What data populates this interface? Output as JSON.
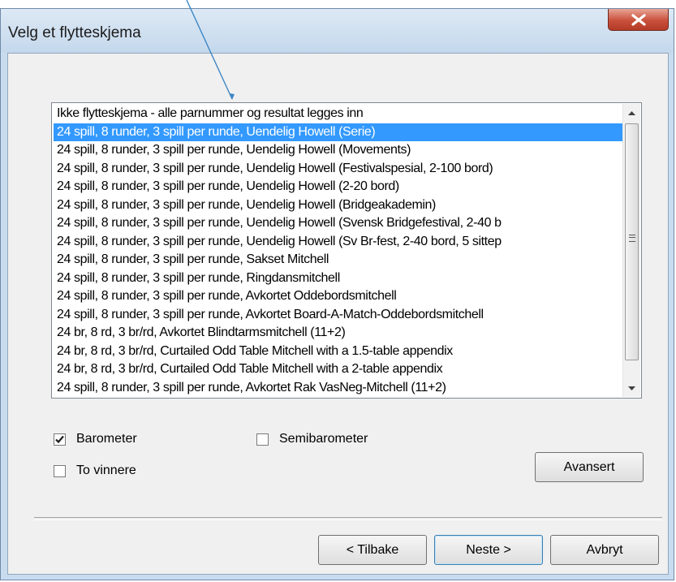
{
  "window": {
    "title": "Velg et flytteskjema"
  },
  "list": {
    "selected_index": 1,
    "items": [
      "Ikke flytteskjema - alle parnummer og resultat legges inn",
      "24 spill, 8 runder, 3 spill per runde, Uendelig Howell (Serie)",
      "24 spill, 8 runder, 3 spill per runde, Uendelig Howell (Movements)",
      "24 spill, 8 runder, 3 spill per runde, Uendelig Howell (Festivalspesial, 2-100 bord)",
      "24 spill, 8 runder, 3 spill per runde, Uendelig Howell (2-20 bord)",
      "24 spill, 8 runder, 3 spill per runde, Uendelig Howell (Bridgeakademin)",
      "24 spill, 8 runder, 3 spill per runde, Uendelig Howell (Svensk Bridgefestival, 2-40 b",
      "24 spill, 8 runder, 3 spill per runde, Uendelig Howell (Sv Br-fest, 2-40 bord, 5 sittep",
      "24 spill, 8 runder, 3 spill per runde, Sakset Mitchell",
      "24 spill, 8 runder, 3 spill per runde, Ringdansmitchell",
      "24 spill, 8 runder, 3 spill per runde, Avkortet Oddebordsmitchell",
      "24 spill, 8 runder, 3 spill per runde, Avkortet Board-A-Match-Oddebordsmitchell",
      "24 br, 8 rd, 3 br/rd, Avkortet Blindtarmsmitchell (11+2)",
      "24 br, 8 rd, 3 br/rd, Curtailed Odd Table Mitchell with a 1.5-table appendix",
      "24 br, 8 rd, 3 br/rd, Curtailed Odd Table Mitchell with a 2-table appendix",
      "24 spill, 8 runder, 3 spill per runde, Avkortet Rak VasNeg-Mitchell (11+2)"
    ]
  },
  "options": {
    "barometer": {
      "label": "Barometer",
      "checked": true
    },
    "semibarometer": {
      "label": "Semibarometer",
      "checked": false
    },
    "to_vinnere": {
      "label": "To vinnere",
      "checked": false
    }
  },
  "buttons": {
    "advanced": "Avansert",
    "back": "< Tilbake",
    "next": "Neste >",
    "cancel": "Avbryt"
  },
  "colors": {
    "selection": "#3399ff",
    "annotation_arrow": "#3f86c3"
  }
}
